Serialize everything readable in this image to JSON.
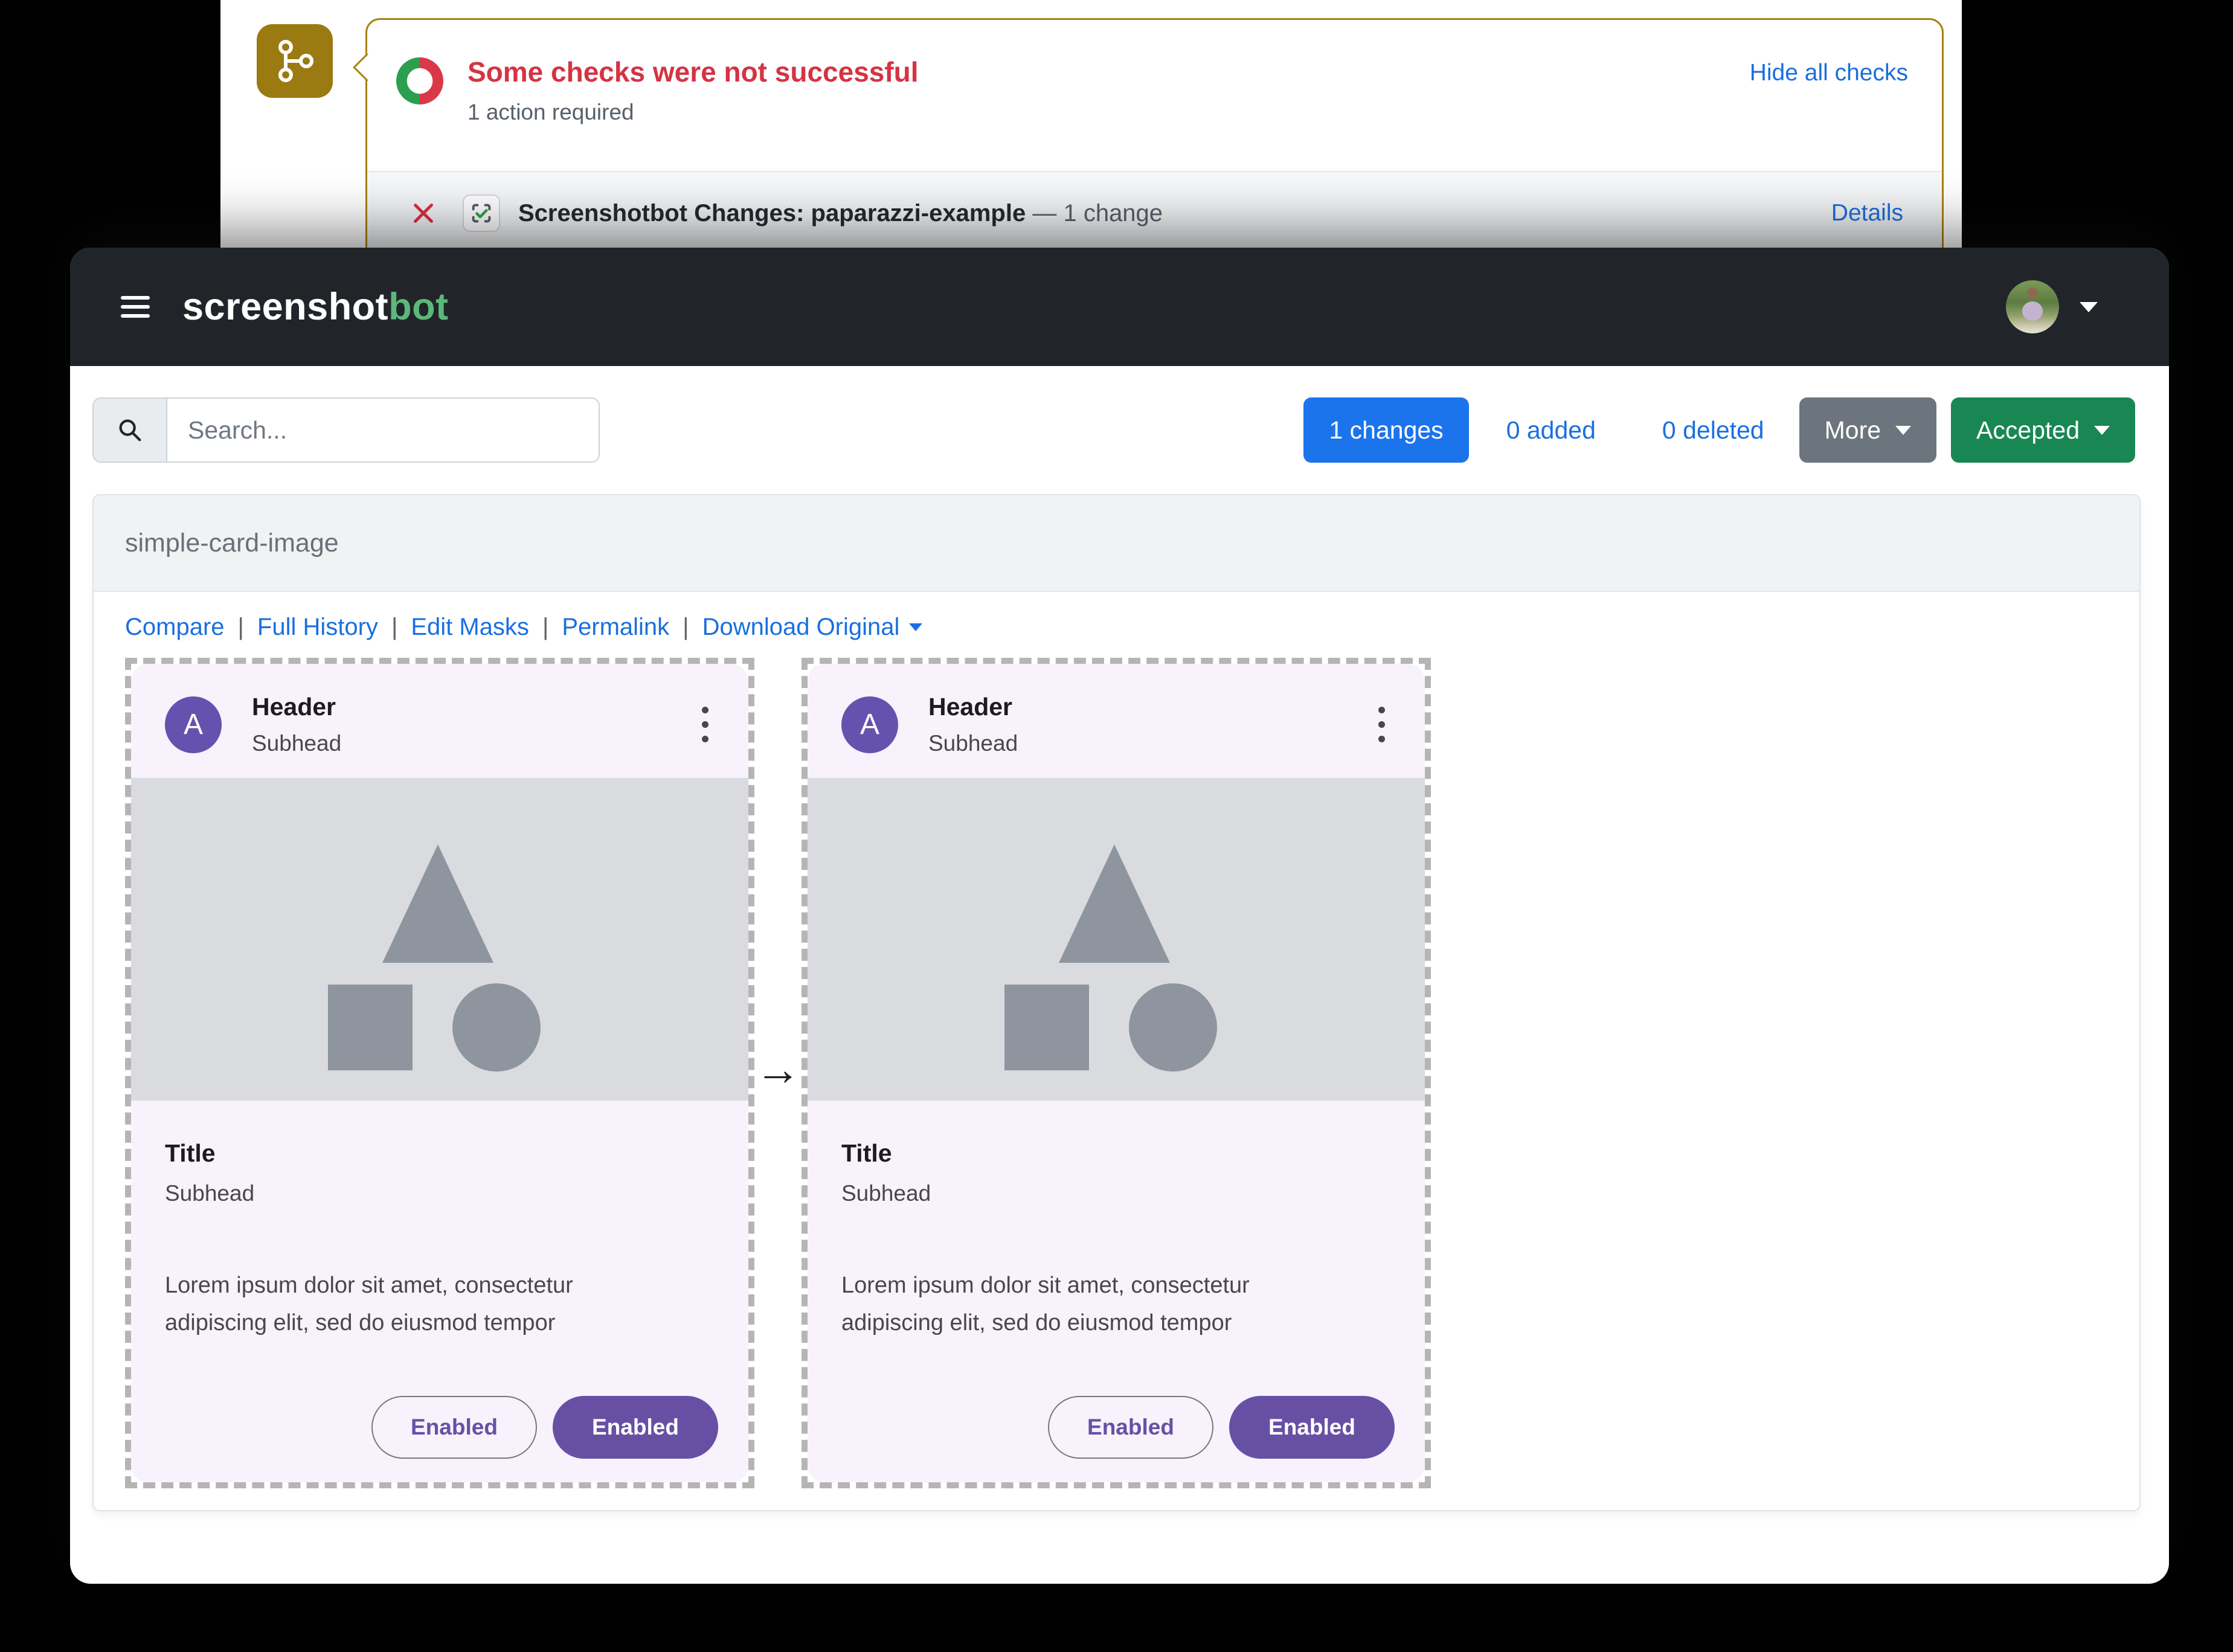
{
  "checks_banner": {
    "status_title": "Some checks were not successful",
    "status_subtitle": "1 action required",
    "hide_link": "Hide all checks",
    "check_row": {
      "name": "Screenshotbot Changes: paparazzi-example",
      "change_count": "— 1 change",
      "details": "Details"
    }
  },
  "navbar": {
    "brand_white": "screenshot",
    "brand_green": "bot"
  },
  "toolbar": {
    "search_placeholder": "Search...",
    "changes_button": "1 changes",
    "added_link": "0 added",
    "deleted_link": "0 deleted",
    "more_button": "More",
    "accepted_button": "Accepted"
  },
  "panel": {
    "title": "simple-card-image",
    "links": [
      "Compare",
      "Full History",
      "Edit Masks",
      "Permalink",
      "Download Original"
    ]
  },
  "comparison": {
    "arrow": "→"
  },
  "screenshot_card": {
    "avatar_letter": "A",
    "header": "Header",
    "header_subhead": "Subhead",
    "title": "Title",
    "subhead": "Subhead",
    "body_line1": "Lorem ipsum dolor sit amet, consectetur",
    "body_line2": "adipiscing elit, sed do eiusmod tempor",
    "button_outlined": "Enabled",
    "button_filled": "Enabled"
  },
  "icons": {
    "branch": "git-branch-icon",
    "donut": "status-donut-icon",
    "failed": "x-icon",
    "app": "screenshotbot-check-icon",
    "menu": "hamburger-menu-icon",
    "search": "search-icon",
    "overflow": "three-dot-menu-icon"
  },
  "colors": {
    "gold_icon": "#9c7a12",
    "callout_border": "#a8810f",
    "status_red": "#d53343",
    "donut_red": "#db3847",
    "donut_green": "#2c9e50",
    "link_blue": "#1b6ede",
    "navbar_dark": "#212529",
    "brand_green": "#5cb87a",
    "button_blue": "#1b74ec",
    "button_gray": "#6c757d",
    "button_green": "#198754",
    "card_lavender": "#f7f2fb",
    "material_purple": "#6750a4",
    "avatar_purple": "#6552ae",
    "image_gray": "#d9dbde",
    "shape_gray": "#8f959e"
  }
}
